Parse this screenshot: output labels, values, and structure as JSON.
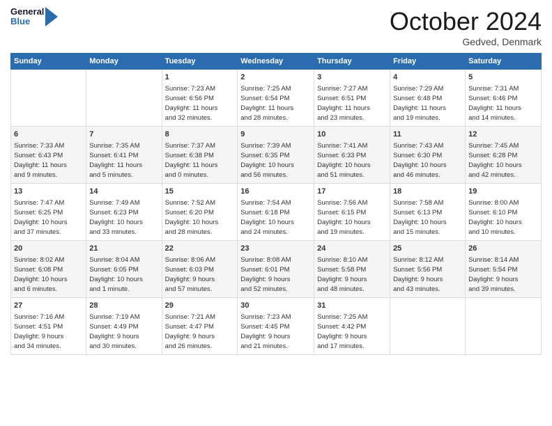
{
  "header": {
    "logo_general": "General",
    "logo_blue": "Blue",
    "month_title": "October 2024",
    "location": "Gedved, Denmark"
  },
  "days_of_week": [
    "Sunday",
    "Monday",
    "Tuesday",
    "Wednesday",
    "Thursday",
    "Friday",
    "Saturday"
  ],
  "weeks": [
    [
      {
        "day": "",
        "info": ""
      },
      {
        "day": "",
        "info": ""
      },
      {
        "day": "1",
        "info": "Sunrise: 7:23 AM\nSunset: 6:56 PM\nDaylight: 11 hours\nand 32 minutes."
      },
      {
        "day": "2",
        "info": "Sunrise: 7:25 AM\nSunset: 6:54 PM\nDaylight: 11 hours\nand 28 minutes."
      },
      {
        "day": "3",
        "info": "Sunrise: 7:27 AM\nSunset: 6:51 PM\nDaylight: 11 hours\nand 23 minutes."
      },
      {
        "day": "4",
        "info": "Sunrise: 7:29 AM\nSunset: 6:48 PM\nDaylight: 11 hours\nand 19 minutes."
      },
      {
        "day": "5",
        "info": "Sunrise: 7:31 AM\nSunset: 6:46 PM\nDaylight: 11 hours\nand 14 minutes."
      }
    ],
    [
      {
        "day": "6",
        "info": "Sunrise: 7:33 AM\nSunset: 6:43 PM\nDaylight: 11 hours\nand 9 minutes."
      },
      {
        "day": "7",
        "info": "Sunrise: 7:35 AM\nSunset: 6:41 PM\nDaylight: 11 hours\nand 5 minutes."
      },
      {
        "day": "8",
        "info": "Sunrise: 7:37 AM\nSunset: 6:38 PM\nDaylight: 11 hours\nand 0 minutes."
      },
      {
        "day": "9",
        "info": "Sunrise: 7:39 AM\nSunset: 6:35 PM\nDaylight: 10 hours\nand 56 minutes."
      },
      {
        "day": "10",
        "info": "Sunrise: 7:41 AM\nSunset: 6:33 PM\nDaylight: 10 hours\nand 51 minutes."
      },
      {
        "day": "11",
        "info": "Sunrise: 7:43 AM\nSunset: 6:30 PM\nDaylight: 10 hours\nand 46 minutes."
      },
      {
        "day": "12",
        "info": "Sunrise: 7:45 AM\nSunset: 6:28 PM\nDaylight: 10 hours\nand 42 minutes."
      }
    ],
    [
      {
        "day": "13",
        "info": "Sunrise: 7:47 AM\nSunset: 6:25 PM\nDaylight: 10 hours\nand 37 minutes."
      },
      {
        "day": "14",
        "info": "Sunrise: 7:49 AM\nSunset: 6:23 PM\nDaylight: 10 hours\nand 33 minutes."
      },
      {
        "day": "15",
        "info": "Sunrise: 7:52 AM\nSunset: 6:20 PM\nDaylight: 10 hours\nand 28 minutes."
      },
      {
        "day": "16",
        "info": "Sunrise: 7:54 AM\nSunset: 6:18 PM\nDaylight: 10 hours\nand 24 minutes."
      },
      {
        "day": "17",
        "info": "Sunrise: 7:56 AM\nSunset: 6:15 PM\nDaylight: 10 hours\nand 19 minutes."
      },
      {
        "day": "18",
        "info": "Sunrise: 7:58 AM\nSunset: 6:13 PM\nDaylight: 10 hours\nand 15 minutes."
      },
      {
        "day": "19",
        "info": "Sunrise: 8:00 AM\nSunset: 6:10 PM\nDaylight: 10 hours\nand 10 minutes."
      }
    ],
    [
      {
        "day": "20",
        "info": "Sunrise: 8:02 AM\nSunset: 6:08 PM\nDaylight: 10 hours\nand 6 minutes."
      },
      {
        "day": "21",
        "info": "Sunrise: 8:04 AM\nSunset: 6:05 PM\nDaylight: 10 hours\nand 1 minute."
      },
      {
        "day": "22",
        "info": "Sunrise: 8:06 AM\nSunset: 6:03 PM\nDaylight: 9 hours\nand 57 minutes."
      },
      {
        "day": "23",
        "info": "Sunrise: 8:08 AM\nSunset: 6:01 PM\nDaylight: 9 hours\nand 52 minutes."
      },
      {
        "day": "24",
        "info": "Sunrise: 8:10 AM\nSunset: 5:58 PM\nDaylight: 9 hours\nand 48 minutes."
      },
      {
        "day": "25",
        "info": "Sunrise: 8:12 AM\nSunset: 5:56 PM\nDaylight: 9 hours\nand 43 minutes."
      },
      {
        "day": "26",
        "info": "Sunrise: 8:14 AM\nSunset: 5:54 PM\nDaylight: 9 hours\nand 39 minutes."
      }
    ],
    [
      {
        "day": "27",
        "info": "Sunrise: 7:16 AM\nSunset: 4:51 PM\nDaylight: 9 hours\nand 34 minutes."
      },
      {
        "day": "28",
        "info": "Sunrise: 7:19 AM\nSunset: 4:49 PM\nDaylight: 9 hours\nand 30 minutes."
      },
      {
        "day": "29",
        "info": "Sunrise: 7:21 AM\nSunset: 4:47 PM\nDaylight: 9 hours\nand 26 minutes."
      },
      {
        "day": "30",
        "info": "Sunrise: 7:23 AM\nSunset: 4:45 PM\nDaylight: 9 hours\nand 21 minutes."
      },
      {
        "day": "31",
        "info": "Sunrise: 7:25 AM\nSunset: 4:42 PM\nDaylight: 9 hours\nand 17 minutes."
      },
      {
        "day": "",
        "info": ""
      },
      {
        "day": "",
        "info": ""
      }
    ]
  ]
}
